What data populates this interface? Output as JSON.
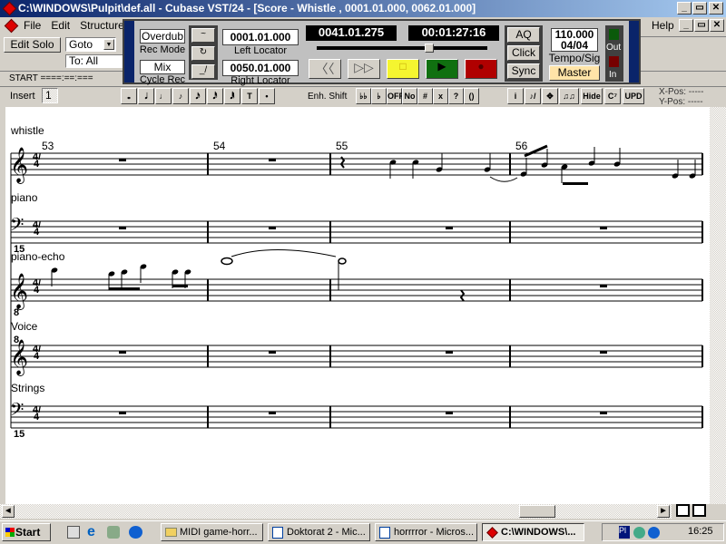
{
  "window": {
    "title": "C:\\WINDOWS\\Pulpit\\def.all - Cubase VST/24 - [Score - Whistle  , 0001.01.000, 0062.01.000]",
    "controls": [
      "_",
      "▭",
      "✕"
    ]
  },
  "menu": {
    "items": [
      "File",
      "Edit",
      "Structure"
    ],
    "help": "Help"
  },
  "left_panel": {
    "edit_solo": "Edit Solo",
    "goto": "Goto",
    "to": "To: All",
    "start": "START ====:==:==="
  },
  "transport": {
    "rec_mode_value": "Overdub",
    "rec_mode_label": "Rec Mode",
    "cycle_rec_value": "Mix",
    "cycle_rec_label": "Cycle Rec",
    "left_locator": "0001.01.000",
    "left_locator_label": "Left Locator",
    "right_locator": "0050.01.000",
    "right_locator_label": "Right Locator",
    "position_bars": "0041.01.275",
    "position_time": "00:01:27:16",
    "position_fraction": 0.66,
    "aq": "AQ",
    "click": "Click",
    "sync": "Sync",
    "tempo": "110.000",
    "signature": "04/04",
    "tempo_label": "Tempo/Sig",
    "master": "Master",
    "out": "Out",
    "in": "In",
    "colors": {
      "stop": "#f5f530",
      "play": "#107010",
      "record": "#b00000",
      "master": "#ffe4a8"
    }
  },
  "toolbar": {
    "insert_label": "Insert",
    "insert_value": "1",
    "note_buttons": [
      "𝅝",
      "𝅗𝅥",
      "♩",
      "♪",
      "𝅘𝅥𝅯",
      "𝅘𝅥𝅰",
      "𝅘𝅥𝅱",
      "T",
      "•"
    ],
    "enh_shift": "Enh. Shift",
    "enh_buttons": [
      "♭♭",
      "♭",
      "OFF",
      "No",
      "#",
      "x",
      "?",
      "()"
    ],
    "tool_buttons": [
      "i",
      "♪/",
      "✥",
      "♫♫",
      "Hide",
      "C⁷",
      "UPD"
    ],
    "x_pos": "X-Pos: -----",
    "y_pos": "Y-Pos: -----"
  },
  "score": {
    "bar_numbers": [
      "53",
      "54",
      "55",
      "56"
    ],
    "staves": [
      {
        "name": "whistle",
        "clef": "treble",
        "time": "4/4"
      },
      {
        "name": "piano",
        "clef": "bass",
        "time": "4/4",
        "octave": "15"
      },
      {
        "name": "piano-echo",
        "clef": "treble",
        "time": "4/4",
        "octave": "8"
      },
      {
        "name": "Voice",
        "clef": "treble",
        "time": "4/4",
        "octave": "8"
      },
      {
        "name": "Strings",
        "clef": "bass",
        "time": "4/4",
        "octave": "15"
      }
    ]
  },
  "taskbar": {
    "start": "Start",
    "tasks": [
      "MIDI game-horr...",
      "Doktorat 2 - Mic...",
      "horrrror - Micros...",
      "C:\\WINDOWS\\..."
    ],
    "clock": "16:25"
  }
}
